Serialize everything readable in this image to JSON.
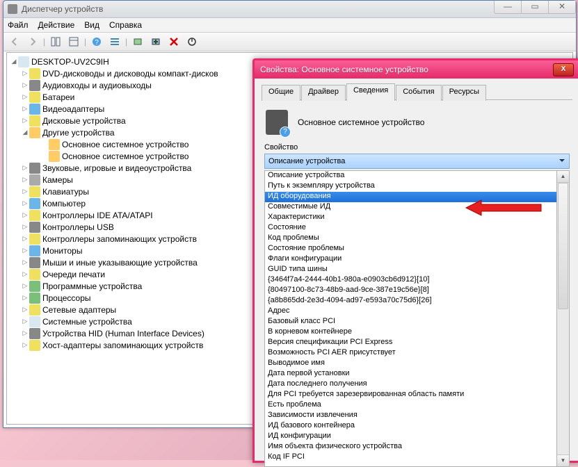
{
  "win": {
    "title": "Диспетчер устройств",
    "menu": {
      "file": "Файл",
      "action": "Действие",
      "view": "Вид",
      "help": "Справка"
    }
  },
  "tree": {
    "root": "DESKTOP-UV2C9IH",
    "items": [
      {
        "label": "DVD-дисководы и дисководы компакт-дисков",
        "ic": "y"
      },
      {
        "label": "Аудиовходы и аудиовыходы",
        "ic": "usb"
      },
      {
        "label": "Батареи",
        "ic": "y"
      },
      {
        "label": "Видеоадаптеры",
        "ic": "mon"
      },
      {
        "label": "Дисковые устройства",
        "ic": "y"
      },
      {
        "label": "Другие устройства",
        "ic": "warn",
        "expanded": true,
        "children": [
          {
            "label": "Основное системное устройство",
            "ic": "warn"
          },
          {
            "label": "Основное системное устройство",
            "ic": "warn"
          }
        ]
      },
      {
        "label": "Звуковые, игровые и видеоустройства",
        "ic": "usb"
      },
      {
        "label": "Камеры",
        "ic": "cam"
      },
      {
        "label": "Клавиатуры",
        "ic": "y"
      },
      {
        "label": "Компьютер",
        "ic": "mon"
      },
      {
        "label": "Контроллеры IDE ATA/ATAPI",
        "ic": "y"
      },
      {
        "label": "Контроллеры USB",
        "ic": "usb"
      },
      {
        "label": "Контроллеры запоминающих устройств",
        "ic": "y"
      },
      {
        "label": "Мониторы",
        "ic": "mon"
      },
      {
        "label": "Мыши и иные указывающие устройства",
        "ic": "usb"
      },
      {
        "label": "Очереди печати",
        "ic": "y"
      },
      {
        "label": "Программные устройства",
        "ic": "cpu"
      },
      {
        "label": "Процессоры",
        "ic": "cpu"
      },
      {
        "label": "Сетевые адаптеры",
        "ic": "y"
      },
      {
        "label": "Системные устройства",
        "ic": "pc"
      },
      {
        "label": "Устройства HID (Human Interface Devices)",
        "ic": "usb"
      },
      {
        "label": "Хост-адаптеры запоминающих устройств",
        "ic": "y"
      }
    ]
  },
  "dlg": {
    "title": "Свойства: Основное системное устройство",
    "device_name": "Основное системное устройство",
    "tabs": {
      "general": "Общие",
      "driver": "Драйвер",
      "details": "Сведения",
      "events": "События",
      "resources": "Ресурсы"
    },
    "property_label": "Свойство",
    "combo_value": "Описание устройства",
    "options": [
      "Описание устройства",
      "Путь к экземпляру устройства",
      "ИД оборудования",
      "Совместимые ИД",
      "Характеристики",
      "Состояние",
      "Код проблемы",
      "Состояние проблемы",
      "Флаги конфигурации",
      "GUID типа шины",
      "{3464f7a4-2444-40b1-980a-e0903cb6d912}[10]",
      "{80497100-8c73-48b9-aad-9ce-387e19c56e}[8]",
      "{a8b865dd-2e3d-4094-ad97-e593a70c75d6}[26]",
      "Адрес",
      "Базовый класс PCI",
      "В корневом контейнере",
      "Версия спецификации PCI Express",
      "Возможность PCI AER присутствует",
      "Выводимое имя",
      "Дата первой установки",
      "Дата последнего получения",
      "Для PCI требуется зарезервированная область памяти",
      "Есть проблема",
      "Зависимости извлечения",
      "ИД базового контейнера",
      "ИД конфигурации",
      "Имя объекта физического устройства",
      "Код IF PCI"
    ],
    "selected_index": 2
  }
}
